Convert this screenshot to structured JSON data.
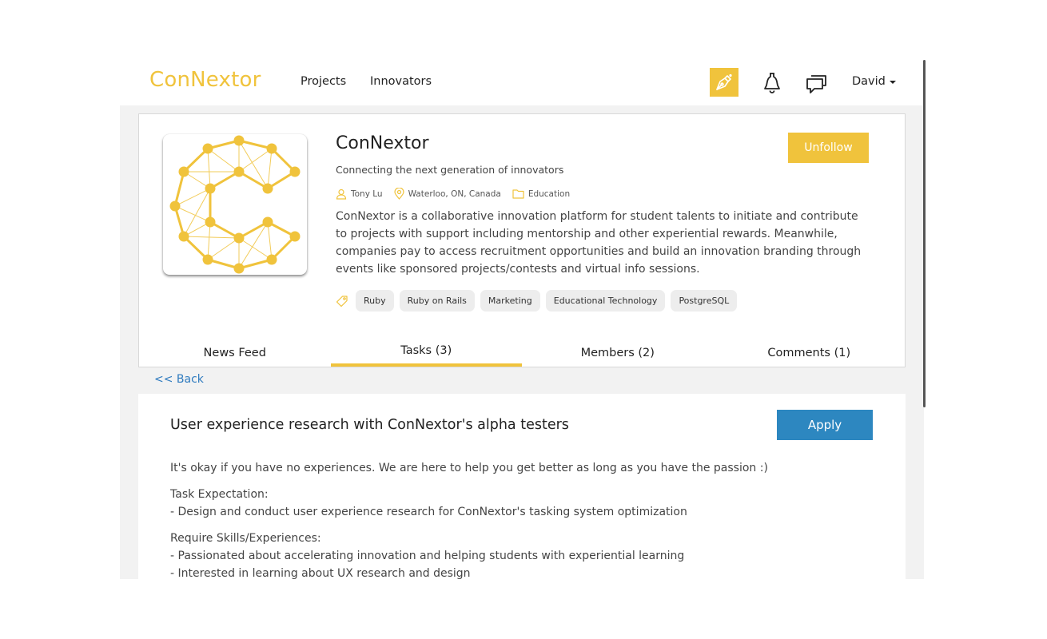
{
  "header": {
    "brand": "ConNextor",
    "nav": {
      "projects": "Projects",
      "innovators": "Innovators"
    },
    "user": "David"
  },
  "project": {
    "title": "ConNextor",
    "tagline": "Connecting the next generation of innovators",
    "owner": "Tony Lu",
    "location": "Waterloo, ON, Canada",
    "category": "Education",
    "description": "ConNextor is a collaborative innovation platform for student talents to initiate and contribute to projects with support including mentorship and other experiential rewards. Meanwhile, companies pay to access recruitment opportunities and build an innovation branding through events like sponsored projects/contests and virtual info sessions.",
    "tags": [
      "Ruby",
      "Ruby on Rails",
      "Marketing",
      "Educational Technology",
      "PostgreSQL"
    ],
    "follow_label": "Unfollow"
  },
  "tabs": [
    {
      "label": "News Feed",
      "active": false
    },
    {
      "label": "Tasks (3)",
      "active": true
    },
    {
      "label": "Members (2)",
      "active": false
    },
    {
      "label": "Comments (1)",
      "active": false
    }
  ],
  "back_label": "<< Back",
  "task": {
    "title": "User experience research with ConNextor's alpha testers",
    "apply_label": "Apply",
    "intro": "It's okay if you have no experiences. We are here to help you get better as long as you have the passion :)",
    "expectation_heading": "Task Expectation:",
    "expectation_items": [
      "- Design and conduct user experience research for ConNextor's tasking system optimization"
    ],
    "skills_heading": "Require Skills/Experiences:",
    "skills_items": [
      "- Passionated about accelerating innovation and helping students with experiential learning",
      "- Interested in learning about UX research and design"
    ]
  },
  "colors": {
    "accent": "#f0c33c",
    "apply": "#2d87c0",
    "link": "#2f7bbf",
    "background": "#f2f2f2"
  },
  "icons": {
    "create": "pen-nib-icon",
    "notifications": "bell-icon",
    "messages": "chat-bubbles-icon",
    "owner": "user-icon",
    "location": "map-pin-icon",
    "category": "folder-icon",
    "tags": "tag-icon"
  }
}
